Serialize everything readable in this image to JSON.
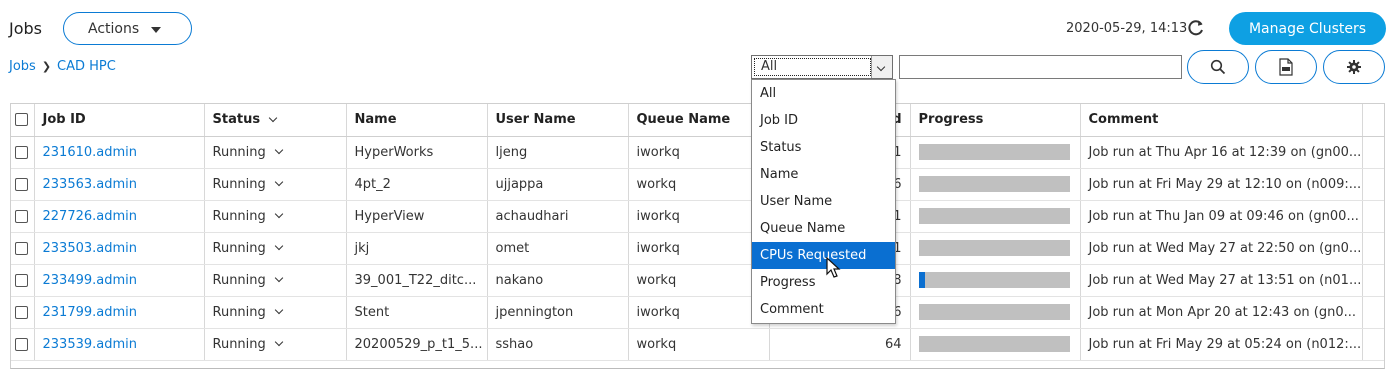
{
  "header": {
    "title": "Jobs",
    "actions_label": "Actions",
    "timestamp": "2020-05-29, 14:13",
    "manage_clusters_label": "Manage Clusters"
  },
  "breadcrumb": [
    "Jobs",
    "CAD HPC"
  ],
  "filter": {
    "selected": "All",
    "search_value": "",
    "options": [
      "All",
      "Job ID",
      "Status",
      "Name",
      "User Name",
      "Queue Name",
      "CPUs Requested",
      "Progress",
      "Comment"
    ],
    "highlighted": "CPUs Requested"
  },
  "table": {
    "columns": [
      "Job ID",
      "Status",
      "Name",
      "User Name",
      "Queue Name",
      "CPUs Requested",
      "Progress",
      "Comment"
    ],
    "visible_cpu_header_fragment": "d",
    "rows": [
      {
        "job_id": "231610.admin",
        "status": "Running",
        "name": "HyperWorks",
        "user": "ljeng",
        "queue": "iworkq",
        "cpus": "1",
        "progress": 0,
        "comment": "Job run at Thu Apr 16 at 12:39 on (gn00..."
      },
      {
        "job_id": "233563.admin",
        "status": "Running",
        "name": "4pt_2",
        "user": "ujjappa",
        "queue": "workq",
        "cpus": "6",
        "progress": 0,
        "comment": "Job run at Fri May 29 at 12:10 on (n009:..."
      },
      {
        "job_id": "227726.admin",
        "status": "Running",
        "name": "HyperView",
        "user": "achaudhari",
        "queue": "iworkq",
        "cpus": "1",
        "progress": 0,
        "comment": "Job run at Thu Jan 09 at 09:46 on (gn00..."
      },
      {
        "job_id": "233503.admin",
        "status": "Running",
        "name": "jkj",
        "user": "omet",
        "queue": "iworkq",
        "cpus": "1",
        "progress": 0,
        "comment": "Job run at Wed May 27 at 22:50 on (gn0..."
      },
      {
        "job_id": "233499.admin",
        "status": "Running",
        "name": "39_001_T22_ditc...",
        "user": "nakano",
        "queue": "workq",
        "cpus": "8",
        "progress": 0.04,
        "comment": "Job run at Wed May 27 at 13:51 on (n01..."
      },
      {
        "job_id": "231799.admin",
        "status": "Running",
        "name": "Stent",
        "user": "jpennington",
        "queue": "iworkq",
        "cpus": "6",
        "progress": 0,
        "comment": "Job run at Mon Apr 20 at 12:43 on (gn0..."
      },
      {
        "job_id": "233539.admin",
        "status": "Running",
        "name": "20200529_p_t1_5...",
        "user": "sshao",
        "queue": "workq",
        "cpus": "64",
        "progress": 0,
        "comment": "Job run at Fri May 29 at 05:24 on (n012:..."
      }
    ]
  },
  "colors": {
    "accent": "#0b7bd4",
    "manage_button": "#0ea0e3",
    "progress_track": "#c0c0c0",
    "progress_fill": "#0b6fd0",
    "dropdown_highlight": "#0a6fd1"
  },
  "icons": {
    "refresh": "refresh-icon",
    "search": "search-icon",
    "csv": "csv-export-icon",
    "settings": "gear-icon"
  }
}
